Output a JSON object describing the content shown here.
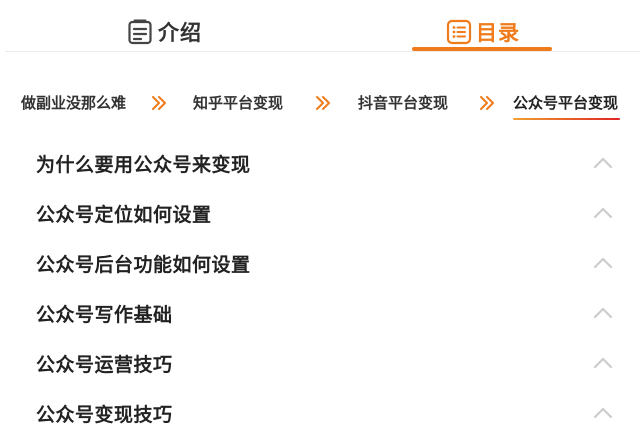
{
  "tabs": {
    "intro": {
      "label": "介绍",
      "icon": "document-icon"
    },
    "toc": {
      "label": "目录",
      "icon": "list-icon",
      "active": true
    }
  },
  "chapters": [
    {
      "label": "做副业没那么难"
    },
    {
      "label": "知乎平台变现"
    },
    {
      "label": "抖音平台变现"
    },
    {
      "label": "公众号平台变现",
      "active": true
    }
  ],
  "toc_items": [
    {
      "title": "为什么要用公众号来变现",
      "icon": "chevron-up-icon"
    },
    {
      "title": "公众号定位如何设置",
      "icon": "chevron-up-icon"
    },
    {
      "title": "公众号后台功能如何设置",
      "icon": "chevron-up-icon"
    },
    {
      "title": "公众号写作基础",
      "icon": "chevron-up-icon"
    },
    {
      "title": "公众号运营技巧",
      "icon": "chevron-up-icon"
    },
    {
      "title": "公众号变现技巧",
      "icon": "chevron-up-icon"
    }
  ],
  "colors": {
    "accent": "#f07b1a",
    "underline_gradient_start": "#f0a030",
    "underline_gradient_end": "#e02424",
    "text": "#222222",
    "chevron": "#cccccc"
  }
}
